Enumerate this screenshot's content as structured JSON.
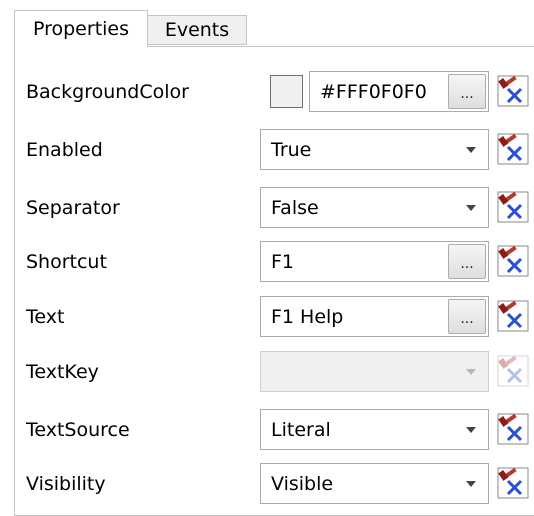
{
  "tabs": [
    {
      "label": "Properties",
      "active": true
    },
    {
      "label": "Events",
      "active": false
    }
  ],
  "ellipsis_label": "...",
  "reset_icon": "reset-to-default-icon",
  "properties": [
    {
      "name": "BackgroundColor",
      "editor": "color",
      "value": "#FFF0F0F0",
      "swatch_color": "#f0f0f0"
    },
    {
      "name": "Enabled",
      "editor": "dropdown",
      "value": "True"
    },
    {
      "name": "Separator",
      "editor": "dropdown",
      "value": "False"
    },
    {
      "name": "Shortcut",
      "editor": "text-ellipsis",
      "value": "F1"
    },
    {
      "name": "Text",
      "editor": "text-ellipsis",
      "value": "F1 Help"
    },
    {
      "name": "TextKey",
      "editor": "dropdown",
      "value": "",
      "disabled": true
    },
    {
      "name": "TextSource",
      "editor": "dropdown",
      "value": "Literal"
    },
    {
      "name": "Visibility",
      "editor": "dropdown",
      "value": "Visible"
    }
  ]
}
